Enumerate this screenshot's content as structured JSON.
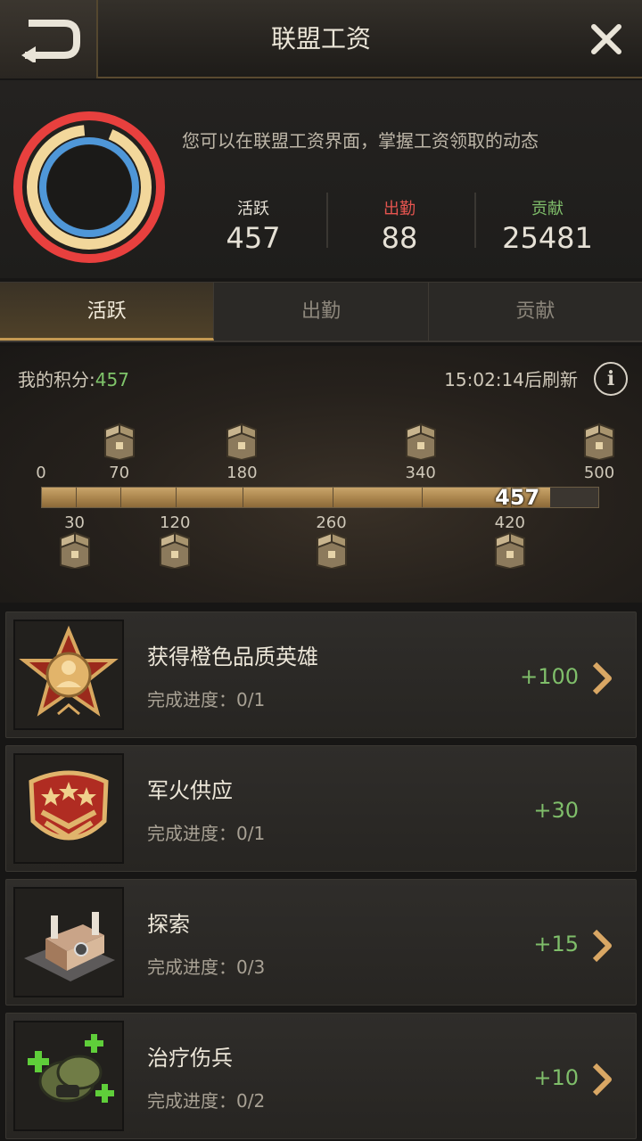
{
  "header": {
    "title": "联盟工资",
    "back_icon": "back-arrow-icon",
    "close_icon": "close-icon"
  },
  "summary": {
    "hint": "您可以在联盟工资界面，掌握工资领取的动态",
    "stats": [
      {
        "label": "活跃",
        "value": "457",
        "color": "#e6e1d6"
      },
      {
        "label": "出勤",
        "value": "88",
        "color": "#e4544f"
      },
      {
        "label": "贡献",
        "value": "25481",
        "color": "#7fbe6a"
      }
    ],
    "ring_colors": {
      "outer": "#e8403e",
      "middle": "#f2d79b",
      "inner": "#4f97d8"
    }
  },
  "tabs": [
    {
      "label": "活跃",
      "active": true
    },
    {
      "label": "出勤",
      "active": false
    },
    {
      "label": "贡献",
      "active": false
    }
  ],
  "progress": {
    "score_label": "我的积分:",
    "score_value": "457",
    "refresh_text": "15:02:14后刷新",
    "info_label": "i",
    "start_label": "0",
    "current": 457,
    "max": 500,
    "bar_value_label": "457",
    "top_milestones": [
      "70",
      "180",
      "340",
      "500"
    ],
    "bottom_milestones": [
      "30",
      "120",
      "260",
      "420"
    ]
  },
  "tasks": [
    {
      "name": "获得橙色品质英雄",
      "progress_label": "完成进度：",
      "progress": "0/1",
      "reward": "+100",
      "has_arrow": true,
      "icon": "hero-medal-icon"
    },
    {
      "name": "军火供应",
      "progress_label": "完成进度：",
      "progress": "0/1",
      "reward": "+30",
      "has_arrow": false,
      "icon": "rank-badge-icon"
    },
    {
      "name": "探索",
      "progress_label": "完成进度：",
      "progress": "0/3",
      "reward": "+15",
      "has_arrow": true,
      "icon": "garage-building-icon"
    },
    {
      "name": "治疗伤兵",
      "progress_label": "完成进度：",
      "progress": "0/2",
      "reward": "+10",
      "has_arrow": true,
      "icon": "heal-helmet-icon"
    }
  ]
}
